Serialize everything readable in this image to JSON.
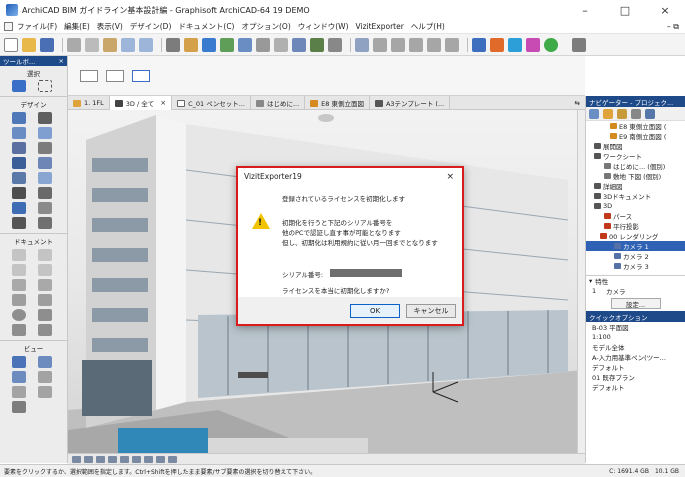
{
  "window": {
    "title": "ArchiCAD BIM ガイドライン基本設計編 - Graphisoft ArchiCAD-64 19 DEMO",
    "minimize": "–",
    "maximize": "□",
    "close": "×"
  },
  "menu": {
    "items": [
      "ファイル(F)",
      "編集(E)",
      "表示(V)",
      "デザイン(D)",
      "ドキュメント(C)",
      "オプション(O)",
      "ウィンドウ(W)",
      "VizitExporter",
      "ヘルプ(H)"
    ],
    "right": "– ⧉"
  },
  "toolbox": {
    "header": "ツールボ...",
    "close": "×",
    "select_label": "選択",
    "design_label": "デザイン",
    "document_label": "ドキュメント",
    "view_label": "ビュー"
  },
  "tabs": [
    {
      "label": "1. 1FL",
      "closable": false
    },
    {
      "label": "3D / 全て",
      "closable": true
    },
    {
      "label": "C_01 ペンセット...",
      "closable": false
    },
    {
      "label": "はじめに...",
      "closable": false
    },
    {
      "label": "E8 東側立面図",
      "closable": false
    },
    {
      "label": "A3テンプレート (...",
      "closable": false
    }
  ],
  "tab_overflow": "⇆",
  "navigator": {
    "header": "ナビゲーター - プロジェク...",
    "tree": [
      {
        "label": "E8 東側立面図 (",
        "indent": 24,
        "color": "#d48a1e"
      },
      {
        "label": "E9 南側立面図 (",
        "indent": 24,
        "color": "#d48a1e"
      },
      {
        "label": "展開図",
        "indent": 8,
        "color": "#555"
      },
      {
        "label": "ワークシート",
        "indent": 8,
        "color": "#555"
      },
      {
        "label": "はじめに... (個別)",
        "indent": 18,
        "color": "#777"
      },
      {
        "label": "敷地 下図 (個別)",
        "indent": 18,
        "color": "#777"
      },
      {
        "label": "詳細図",
        "indent": 8,
        "color": "#555"
      },
      {
        "label": "3Dドキュメント",
        "indent": 8,
        "color": "#555"
      },
      {
        "label": "3D",
        "indent": 8,
        "color": "#555"
      },
      {
        "label": "パース",
        "indent": 18,
        "color": "#c0391b"
      },
      {
        "label": "平行投影",
        "indent": 18,
        "color": "#c0391b"
      },
      {
        "label": "00 レンダリング",
        "indent": 14,
        "color": "#c0391b"
      },
      {
        "label": "カメラ 1",
        "indent": 28,
        "color": "#5571a8",
        "selected": true
      },
      {
        "label": "カメラ 2",
        "indent": 28,
        "color": "#5571a8"
      },
      {
        "label": "カメラ 3",
        "indent": 28,
        "color": "#5571a8"
      }
    ],
    "property_title": "特性",
    "camera_num": "1",
    "camera_name": "カメラ",
    "settings_button": "設定...",
    "quick_options_title": "クイックオプション",
    "quick_options": [
      "B-03 平面図",
      "1:100",
      "モデル全体",
      "A-入力用基準ペン(ツー...",
      "デフォルト",
      "01 既存プラン",
      "デフォルト"
    ]
  },
  "dialog": {
    "title": "VizitExporter19",
    "close": "×",
    "line1": "登録されているライセンスを初期化します",
    "line2": "初期化を行うと下記のシリアル番号を",
    "line3": "他のPCで認証し直す事が可能となります",
    "line4": "但し、初期化は利用規約に従い月一回までとなります",
    "serial_label": "シリアル番号:",
    "confirm": "ライセンスを本当に初期化しますか?",
    "ok": "OK",
    "cancel": "キャンセル"
  },
  "status": {
    "hint": "要素をクリックするか、選択範囲を指定します。Ctrl+Shiftを押したまま要素/サブ要素の選択を切り替えて下さい。",
    "disk": "C: 1691.4 GB",
    "mem": "10.1 GB"
  }
}
